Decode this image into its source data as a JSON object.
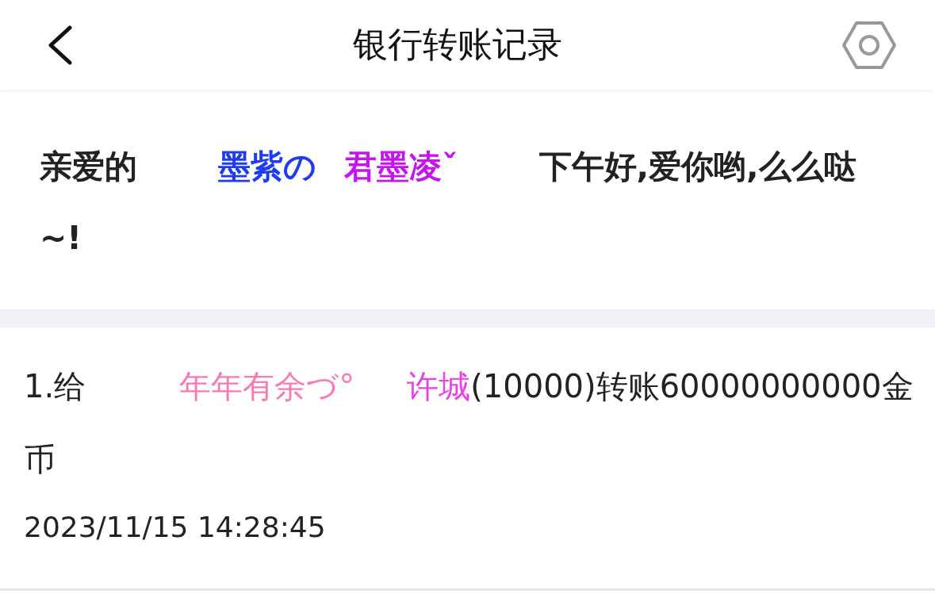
{
  "header": {
    "title": "银行转账记录"
  },
  "greeting": {
    "segments": [
      {
        "kind": "plain",
        "text": "亲爱的"
      },
      {
        "kind": "gradient",
        "text": "墨紫の",
        "color": "#1f3cf0"
      },
      {
        "kind": "gradient",
        "text": "君墨凌ˇ",
        "color": "#c614f0"
      },
      {
        "kind": "plain",
        "text": "下午好,爱你哟,么么哒~!"
      }
    ]
  },
  "records": [
    {
      "segments": [
        {
          "kind": "plain",
          "text": "1.给"
        },
        {
          "kind": "gradient",
          "text": "年年有余づ°",
          "color": "#f77ab4"
        },
        {
          "kind": "gradient",
          "text": "许城",
          "color": "#ee3ee6"
        },
        {
          "kind": "plain",
          "text": "(10000)转账60000000000金币"
        }
      ],
      "time": "2023/11/15 14:28:45"
    }
  ]
}
